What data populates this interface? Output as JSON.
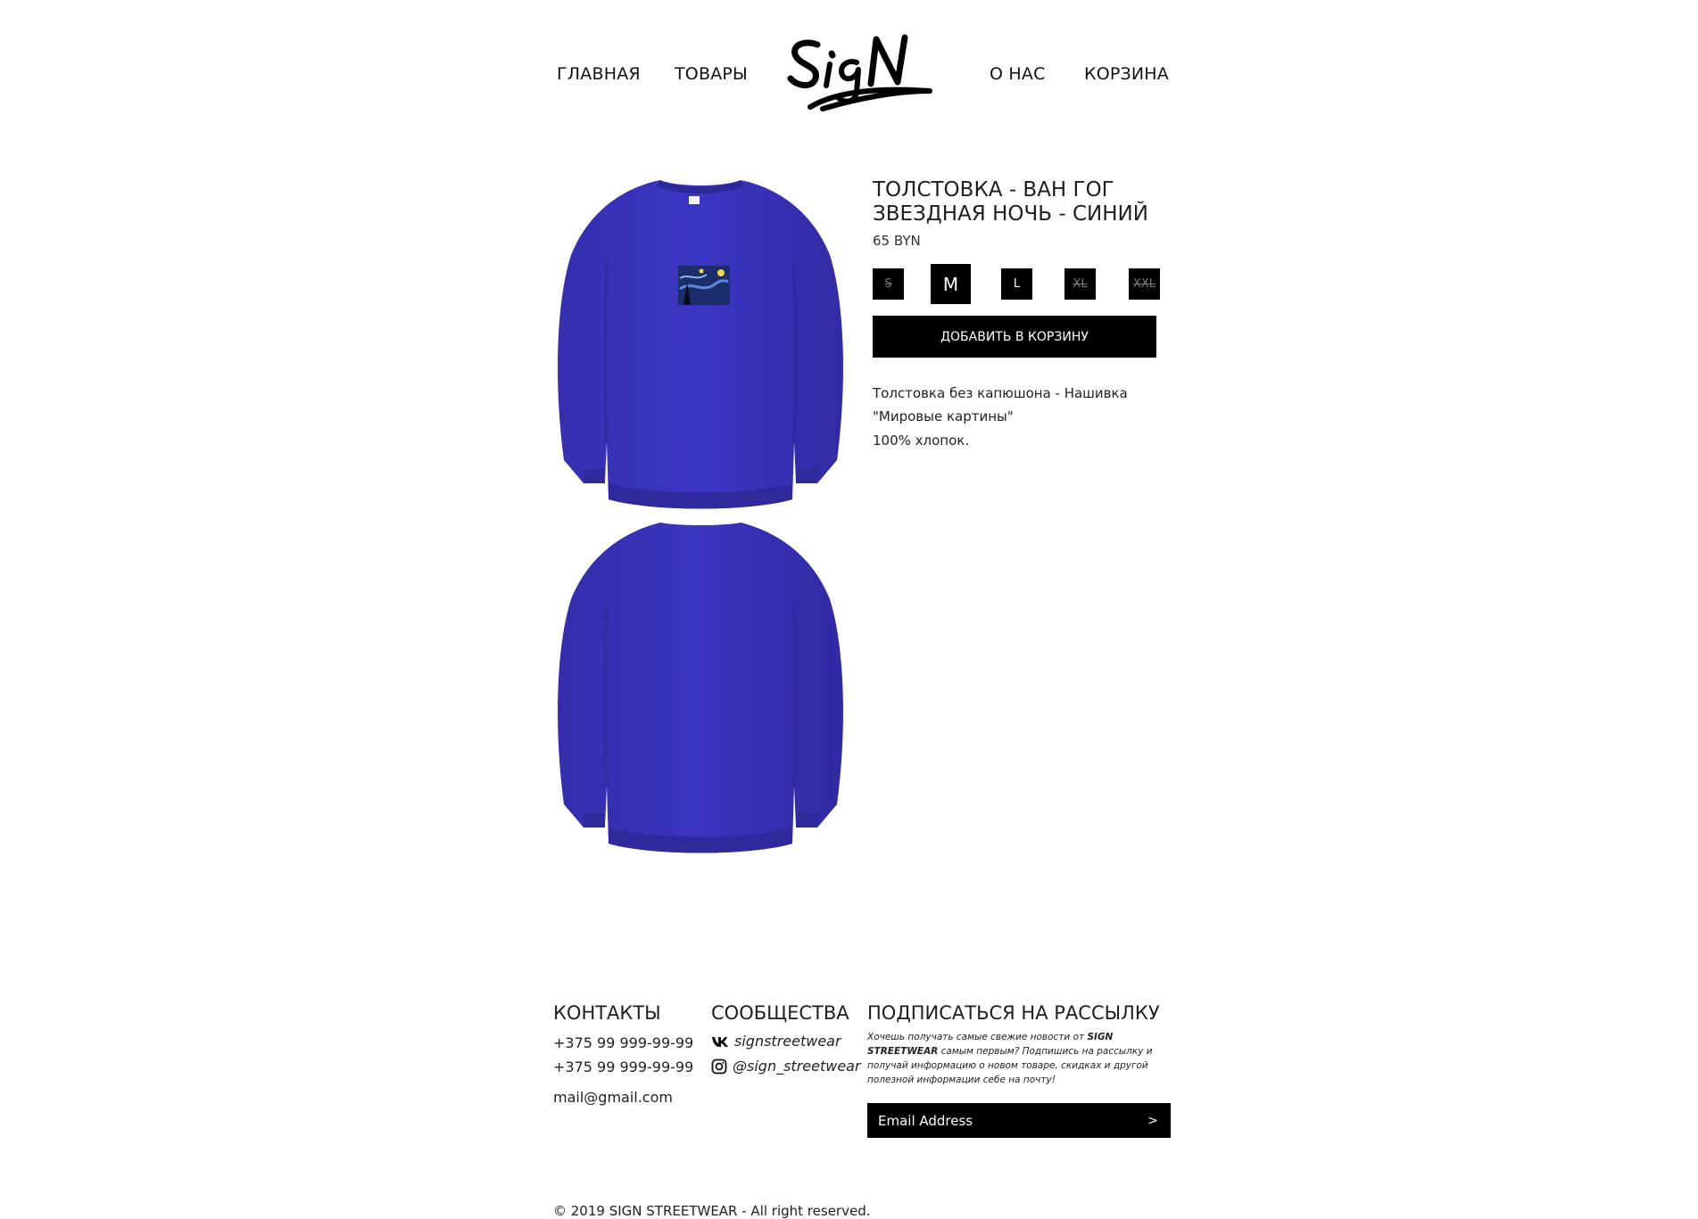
{
  "nav": {
    "home": "ГЛАВНАЯ",
    "products": "ТОВАРЫ",
    "logo_text": "SIGN",
    "about": "О НАС",
    "cart": "КОРЗИНА"
  },
  "product": {
    "title_line1": "ТОЛСТОВКА - ВАН ГОГ",
    "title_line2": "ЗВЕЗДНАЯ НОЧЬ - СИНИЙ",
    "price": "65 BYN",
    "sizes": [
      {
        "label": "S",
        "available": false,
        "selected": false
      },
      {
        "label": "M",
        "available": true,
        "selected": true
      },
      {
        "label": "L",
        "available": true,
        "selected": false
      },
      {
        "label": "XL",
        "available": false,
        "selected": false
      },
      {
        "label": "XXL",
        "available": false,
        "selected": false
      }
    ],
    "add_to_cart": "ДОБАВИТЬ В КОРЗИНУ",
    "description_lines": [
      "Толстовка без капюшона - Нашивка",
      "\"Мировые картины\"",
      "100% хлопок."
    ],
    "color": "#3a33b8"
  },
  "footer": {
    "contacts_heading": "КОНТАКТЫ",
    "phone1": "+375 99 999-99-99",
    "phone2": "+375 99 999-99-99",
    "email": "mail@gmail.com",
    "communities_heading": "СООБЩЕСТВА",
    "vk": {
      "icon": "vk-icon",
      "label": "signstreetwear"
    },
    "instagram": {
      "icon": "instagram-icon",
      "label": "@sign_streetwear"
    },
    "newsletter_heading": "ПОДПИСАТЬСЯ НА РАССЫЛКУ",
    "newsletter_before": "Хочешь получать самые свежие новости от ",
    "newsletter_brand": "SIGN STREETWEAR",
    "newsletter_after": " самым первым? Подпишись на рассылку и получай информацию о новом товаре, скидках и другой полезной информации себе на почту!",
    "email_placeholder": "Email Address",
    "submit_label": ">",
    "copyright": "© 2019 SIGN STREETWEAR - All right reserved."
  }
}
